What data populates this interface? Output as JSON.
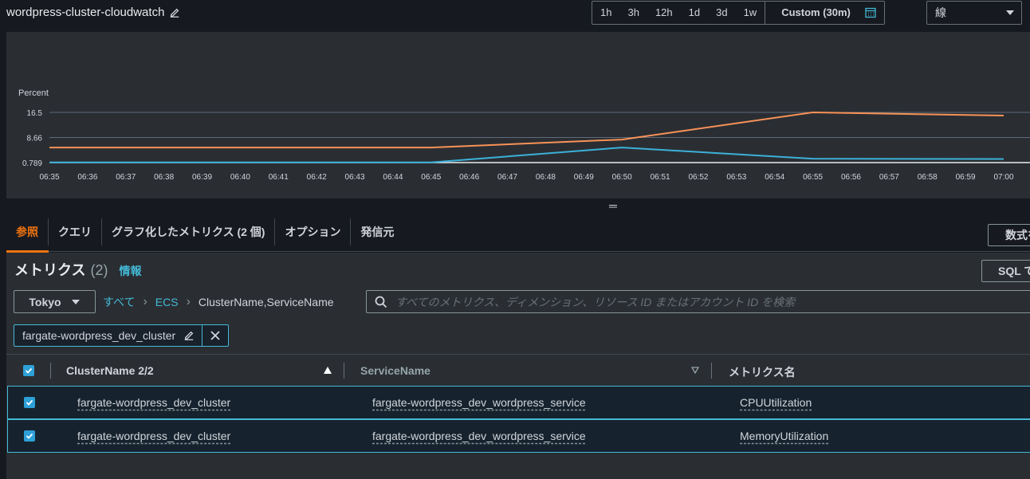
{
  "header": {
    "title": "wordpress-cluster-cloudwatch",
    "ranges": [
      "1h",
      "3h",
      "12h",
      "1d",
      "3d",
      "1w"
    ],
    "custom_range": "Custom (30m)",
    "chart_type": "線"
  },
  "chart_data": {
    "type": "line",
    "ylabel": "Percent",
    "yticks": [
      "16.5",
      "8.66",
      "0.789"
    ],
    "ylim": [
      0.789,
      16.5
    ],
    "x": [
      "06:35",
      "06:36",
      "06:37",
      "06:38",
      "06:39",
      "06:40",
      "06:41",
      "06:42",
      "06:43",
      "06:44",
      "06:45",
      "06:46",
      "06:47",
      "06:48",
      "06:49",
      "06:50",
      "06:51",
      "06:52",
      "06:53",
      "06:54",
      "06:55",
      "06:56",
      "06:57",
      "06:58",
      "06:59",
      "07:00"
    ],
    "series": [
      {
        "color": "#f89256",
        "points": [
          [
            "06:35",
            5.5
          ],
          [
            "06:45",
            5.5
          ],
          [
            "06:50",
            8.0
          ],
          [
            "06:55",
            16.5
          ],
          [
            "07:00",
            15.5
          ]
        ]
      },
      {
        "color": "#3cb1d8",
        "points": [
          [
            "06:35",
            0.85
          ],
          [
            "06:45",
            0.85
          ],
          [
            "06:50",
            5.5
          ],
          [
            "06:55",
            2.0
          ],
          [
            "07:00",
            1.9
          ]
        ]
      }
    ]
  },
  "tabs": [
    "参照",
    "クエリ",
    "グラフ化したメトリクス (2 個)",
    "オプション",
    "発信元"
  ],
  "formula_button": "数式を",
  "metrics": {
    "heading": "メトリクス",
    "count": "(2)",
    "info": "情報",
    "sql_button": "SQL で"
  },
  "region": "Tokyo",
  "breadcrumb": {
    "all": "すべて",
    "namespace": "ECS",
    "dimension": "ClusterName,ServiceName"
  },
  "search": {
    "placeholder": "すべてのメトリクス、ディメンション、リソース ID またはアカウント ID を検索"
  },
  "filter_token": "fargate-wordpress_dev_cluster",
  "table": {
    "headers": [
      "ClusterName 2/2",
      "ServiceName",
      "メトリクス名"
    ],
    "rows": [
      {
        "cluster": "fargate-wordpress_dev_cluster",
        "service": "fargate-wordpress_dev_wordpress_service",
        "metric": "CPUUtilization"
      },
      {
        "cluster": "fargate-wordpress_dev_cluster",
        "service": "fargate-wordpress_dev_wordpress_service",
        "metric": "MemoryUtilization"
      }
    ]
  }
}
